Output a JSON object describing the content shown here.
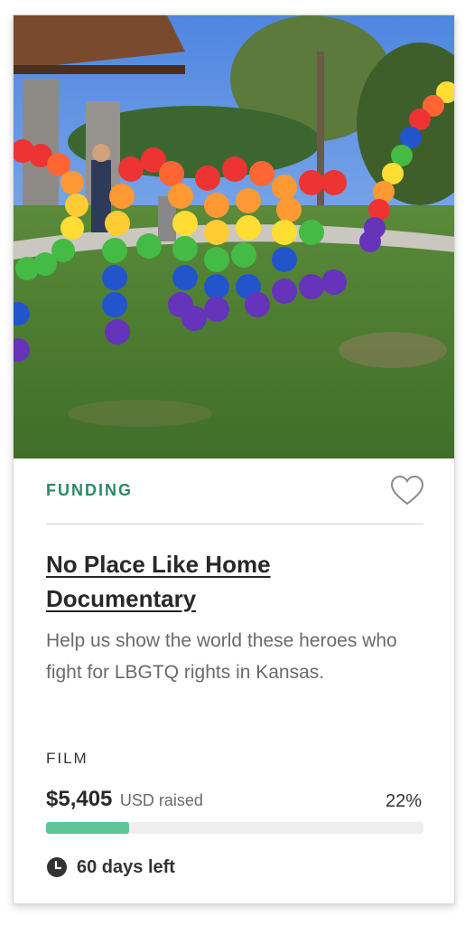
{
  "card": {
    "status": "FUNDING",
    "title": "No Place Like Home Documentary",
    "description": "Help us show the world these heroes who fight for LBGTQ rights in Kansas.",
    "category": "FILM",
    "amount_raised": "$5,405",
    "currency_label": "USD raised",
    "percent_label": "22%",
    "percent_funded": 0.22,
    "days_left": "60 days left"
  },
  "colors": {
    "status_green": "#2b8a63",
    "progress_fill": "#5fc496",
    "progress_track": "#efefef"
  },
  "icons": {
    "favorite": "heart-outline-icon",
    "time": "clock-icon"
  }
}
